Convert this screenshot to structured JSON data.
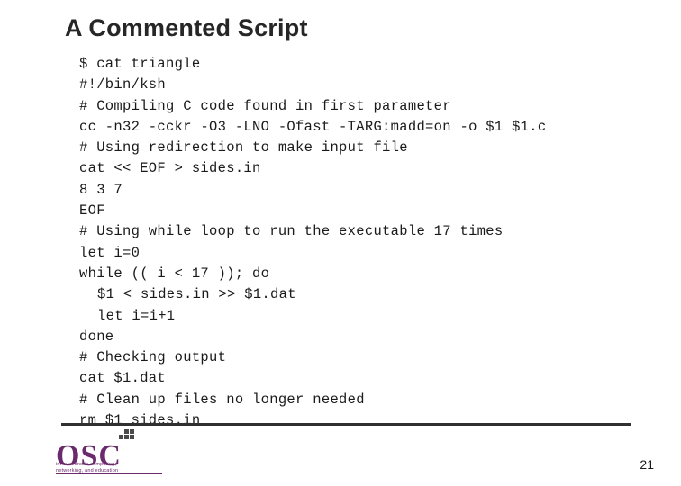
{
  "slide": {
    "title": "A Commented Script",
    "page_number": "21"
  },
  "code": {
    "lines": [
      {
        "text": "$ cat triangle",
        "indent": 0
      },
      {
        "text": "#!/bin/ksh",
        "indent": 0
      },
      {
        "text": "# Compiling C code found in first parameter",
        "indent": 0
      },
      {
        "text": "cc -n32 -cckr -O3 -LNO -Ofast -TARG:madd=on -o $1 $1.c",
        "indent": 0
      },
      {
        "text": "# Using redirection to make input file",
        "indent": 0
      },
      {
        "text": "cat << EOF > sides.in",
        "indent": 0
      },
      {
        "text": "8 3 7",
        "indent": 0
      },
      {
        "text": "EOF",
        "indent": 0
      },
      {
        "text": "# Using while loop to run the executable 17 times",
        "indent": 0
      },
      {
        "text": "let i=0",
        "indent": 0
      },
      {
        "text": "while (( i < 17 )); do",
        "indent": 0
      },
      {
        "text": "$1 < sides.in >> $1.dat",
        "indent": 1
      },
      {
        "text": "let i=i+1",
        "indent": 1
      },
      {
        "text": "done",
        "indent": 0
      },
      {
        "text": "# Checking output",
        "indent": 0
      },
      {
        "text": "cat $1.dat",
        "indent": 0
      },
      {
        "text": "# Clean up files no longer needed",
        "indent": 0
      },
      {
        "text": "rm $1 sides.in",
        "indent": 0
      }
    ]
  },
  "logo": {
    "wordmark": "OSC",
    "tagline_line1": "innovations in computing,",
    "tagline_line2": "networking, and education"
  }
}
